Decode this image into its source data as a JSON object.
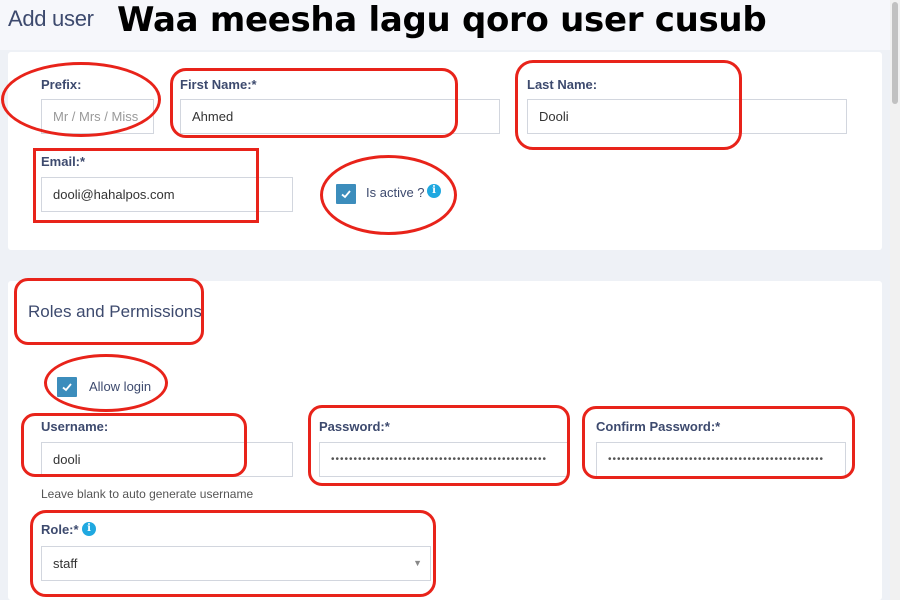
{
  "header": {
    "title": "Add user",
    "caption": "Waa meesha lagu qoro user cusub"
  },
  "user_form": {
    "prefix_label": "Prefix:",
    "prefix_placeholder": "Mr / Mrs / Miss",
    "prefix_value": "",
    "first_name_label": "First Name:*",
    "first_name_value": "Ahmed",
    "last_name_label": "Last Name:",
    "last_name_value": "Dooli",
    "email_label": "Email:*",
    "email_value": "dooli@hahalpos.com",
    "is_active_label": "Is active ?",
    "is_active_checked": true,
    "info_icon": "info-icon"
  },
  "roles": {
    "section_title": "Roles and Permissions",
    "allow_login_label": "Allow login",
    "allow_login_checked": true,
    "username_label": "Username:",
    "username_value": "dooli",
    "username_help": "Leave blank to auto generate username",
    "password_label": "Password:*",
    "password_value": "••••••••••••••••••••••••••••••••••••••••••••••••",
    "confirm_password_label": "Confirm Password:*",
    "confirm_password_value": "••••••••••••••••••••••••••••••••••••••••••••••••",
    "role_label": "Role:*",
    "role_value": "staff"
  },
  "colors": {
    "accent": "#3c8dbc",
    "annotation": "#e8231a",
    "label": "#3d4a6e",
    "info": "#1fa8e0"
  }
}
